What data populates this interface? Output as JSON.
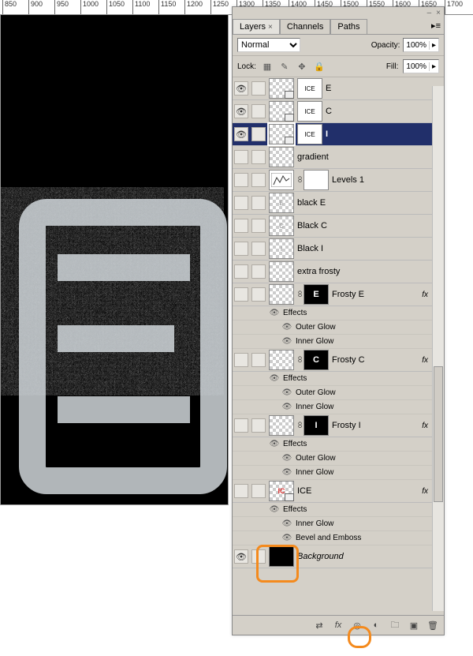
{
  "ruler": {
    "marks": [
      "850",
      "900",
      "950",
      "1000",
      "1050",
      "1100",
      "1150",
      "1200",
      "1250",
      "1300",
      "1350",
      "1400",
      "1450",
      "1500",
      "1550",
      "1600",
      "1650",
      "1700"
    ]
  },
  "panel": {
    "tabs": {
      "layers": "Layers",
      "channels": "Channels",
      "paths": "Paths"
    },
    "blend_mode": "Normal",
    "opacity_label": "Opacity:",
    "opacity_value": "100%",
    "lock_label": "Lock:",
    "fill_label": "Fill:",
    "fill_value": "100%"
  },
  "layers": {
    "e": {
      "name": "E",
      "mask": "ICE"
    },
    "c": {
      "name": "C",
      "mask": "ICE"
    },
    "i": {
      "name": "I",
      "mask": "ICE"
    },
    "gradient": {
      "name": "gradient"
    },
    "levels": {
      "name": "Levels 1"
    },
    "black_e": {
      "name": "black E",
      "glyph": "E"
    },
    "black_c": {
      "name": "Black C",
      "glyph": "C"
    },
    "black_i": {
      "name": "Black I",
      "glyph": "I"
    },
    "extra_frosty": {
      "name": "extra frosty"
    },
    "frosty_e": {
      "name": "Frosty E",
      "glyph": "E"
    },
    "frosty_c": {
      "name": "Frosty C",
      "glyph": "C"
    },
    "frosty_i": {
      "name": "Frosty I",
      "glyph": "I"
    },
    "ice": {
      "name": "ICE",
      "glyph": "IC"
    },
    "background": {
      "name": "Background"
    }
  },
  "fx": {
    "label": "fx",
    "effects": "Effects",
    "outer_glow": "Outer Glow",
    "inner_glow": "Inner Glow",
    "bevel_emboss": "Bevel and Emboss"
  },
  "icons": {
    "minimize": "–",
    "close": "×",
    "menu": "▸≡"
  }
}
